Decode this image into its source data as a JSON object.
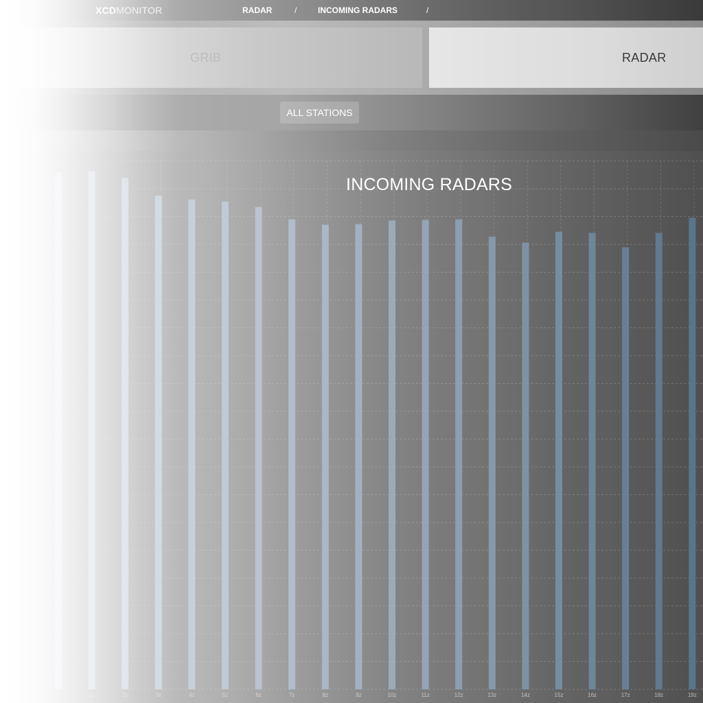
{
  "header": {
    "brand_bold": "XCD",
    "brand_light": "MONITOR",
    "breadcrumb": [
      {
        "label": "RADAR"
      },
      {
        "label": "INCOMING RADARS"
      }
    ],
    "separator": "/"
  },
  "tabs": [
    {
      "label": "GRIB",
      "active": false
    },
    {
      "label": "RADAR",
      "active": true
    }
  ],
  "filters": {
    "all_stations_label": "ALL STATIONS"
  },
  "colors": {
    "bar_start": "#e6ebf1",
    "bar_end": "#5a7791",
    "grid": "#ffffff"
  },
  "chart_data": {
    "type": "bar",
    "title": "INCOMING RADARS",
    "xlabel": "",
    "ylabel": "",
    "grid": true,
    "categories": [
      "0z",
      "1z",
      "2z",
      "3z",
      "4z",
      "5z",
      "6z",
      "7z",
      "8z",
      "9z",
      "10z",
      "11z",
      "12z",
      "13z",
      "14z",
      "15z",
      "16z",
      "17z",
      "18z",
      "19z"
    ],
    "values": [
      96.0,
      96.2,
      95.0,
      91.7,
      91.0,
      90.6,
      89.6,
      87.3,
      86.3,
      86.4,
      87.1,
      87.2,
      87.3,
      84.1,
      83.0,
      85.0,
      84.8,
      82.1,
      84.8,
      87.6
    ],
    "ylim": [
      0,
      100
    ]
  }
}
